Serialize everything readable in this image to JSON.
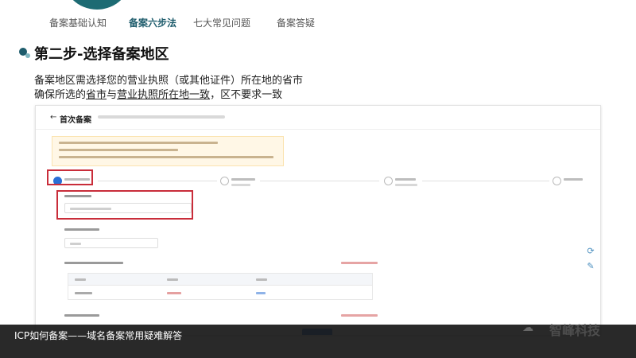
{
  "nav": {
    "tabs": [
      {
        "label": "备案基础认知",
        "active": false
      },
      {
        "label": "备案六步法",
        "active": true
      },
      {
        "label": "七大常见问题",
        "active": false
      },
      {
        "label": "备案答疑",
        "active": false
      }
    ]
  },
  "section": {
    "title": "第二步-选择备案地区",
    "line1": "备案地区需选择您的营业执照（或其他证件）所在地的省市",
    "line2_prefix": "确保所选的",
    "line2_u1": "省市",
    "line2_mid": "与",
    "line2_u2": "营业执照所在地一致",
    "line2_suffix": "，区不要求一致"
  },
  "screenshot": {
    "title": "首次备案",
    "back_icon": "arrow-left-icon"
  },
  "caption": {
    "text": "ICP如何备案——域名备案常用疑难解答"
  },
  "watermark": {
    "text": "智峰科技",
    "icon": "logo-icon"
  },
  "colors": {
    "accent": "#1e5c6c",
    "highlight_box": "#c92d3a",
    "primary_button": "#2b6fd6"
  }
}
